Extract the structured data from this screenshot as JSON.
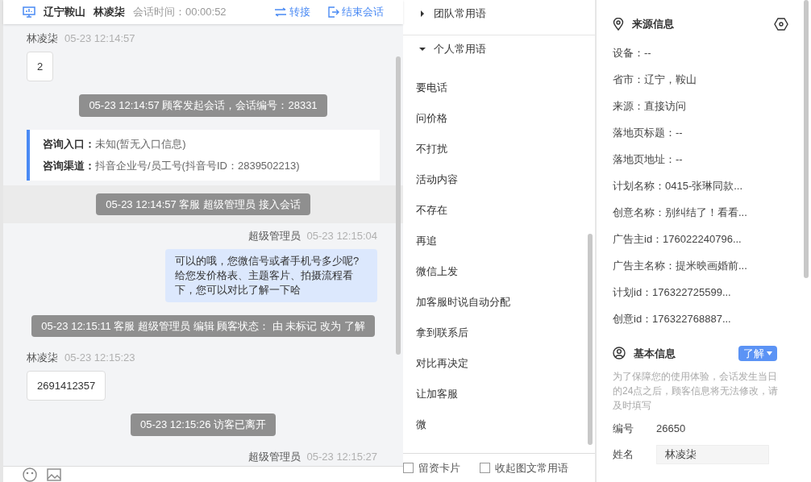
{
  "header": {
    "region": "辽宁鞍山",
    "visitor": "林凌柒",
    "duration_label": "会话时间：",
    "duration": "00:00:52",
    "actions": [
      {
        "kind": "transfer",
        "label": "转接"
      },
      {
        "kind": "end",
        "label": "结束会话"
      }
    ]
  },
  "messages": [
    {
      "kind": "customer",
      "sender": "林凌柒",
      "time": "05-23 12:14:57",
      "text": "2"
    },
    {
      "kind": "system",
      "text": "05-23 12:14:57 顾客发起会话，会话编号：28331"
    },
    {
      "kind": "info",
      "lines": [
        {
          "label": "咨询入口：",
          "value": "未知(暂无入口信息)"
        },
        {
          "label": "咨询渠道：",
          "value": "抖音企业号/员工号(抖音号ID：2839502213)"
        }
      ]
    },
    {
      "kind": "system",
      "text": "05-23 12:14:57 客服 超级管理员 接入会话",
      "highlighted": true
    },
    {
      "kind": "agent",
      "sender": "超级管理员",
      "time": "05-23 12:15:04",
      "text": "可以的哦，您微信号或者手机号多少呢?给您发价格表、主题客片、拍摄流程看下，您可以对比了解一下哈"
    },
    {
      "kind": "system",
      "text": "05-23 12:15:11 客服 超级管理员 编辑 顾客状态： 由 未标记 改为 了解"
    },
    {
      "kind": "customer",
      "sender": "林凌柒",
      "time": "05-23 12:15:23",
      "text": "2691412357"
    },
    {
      "kind": "system",
      "text": "05-23 12:15:26 访客已离开"
    },
    {
      "kind": "agent",
      "sender": "超级管理员",
      "time": "05-23 12:15:27"
    }
  ],
  "phrases": {
    "groups": [
      {
        "label": "团队常用语",
        "expanded": false
      },
      {
        "label": "个人常用语",
        "expanded": true
      }
    ],
    "items": [
      "要电话",
      "问价格",
      "不打扰",
      "活动内容",
      "不存在",
      "再追",
      "微信上发",
      "加客服时说自动分配",
      "拿到联系后",
      "对比再决定",
      "让加客服",
      "微"
    ],
    "options": [
      {
        "label": "留资卡片",
        "checked": false
      },
      {
        "label": "收起图文常用语",
        "checked": false
      }
    ]
  },
  "source_info": {
    "title": "来源信息",
    "fields": [
      "设备：--",
      "省市：辽宁，鞍山",
      "来源：直接访问",
      "落地页标题：--",
      "落地页地址：--",
      "计划名称：0415-张琳同款...",
      "创意名称：别纠结了！看看...",
      "广告主id：176022240796...",
      "广告主名称：提米映画婚前...",
      "计划id：176322725599...",
      "创意id：176322768887..."
    ]
  },
  "basic_info": {
    "title": "基本信息",
    "status": "了解",
    "note": "为了保障您的使用体验，会话发生当日的24点之后，顾客信息将无法修改，请及时填写",
    "fields": [
      {
        "kind": "text",
        "label": "编号",
        "value": "26650"
      },
      {
        "kind": "input",
        "label": "姓名",
        "value": "林凌柒"
      }
    ]
  }
}
